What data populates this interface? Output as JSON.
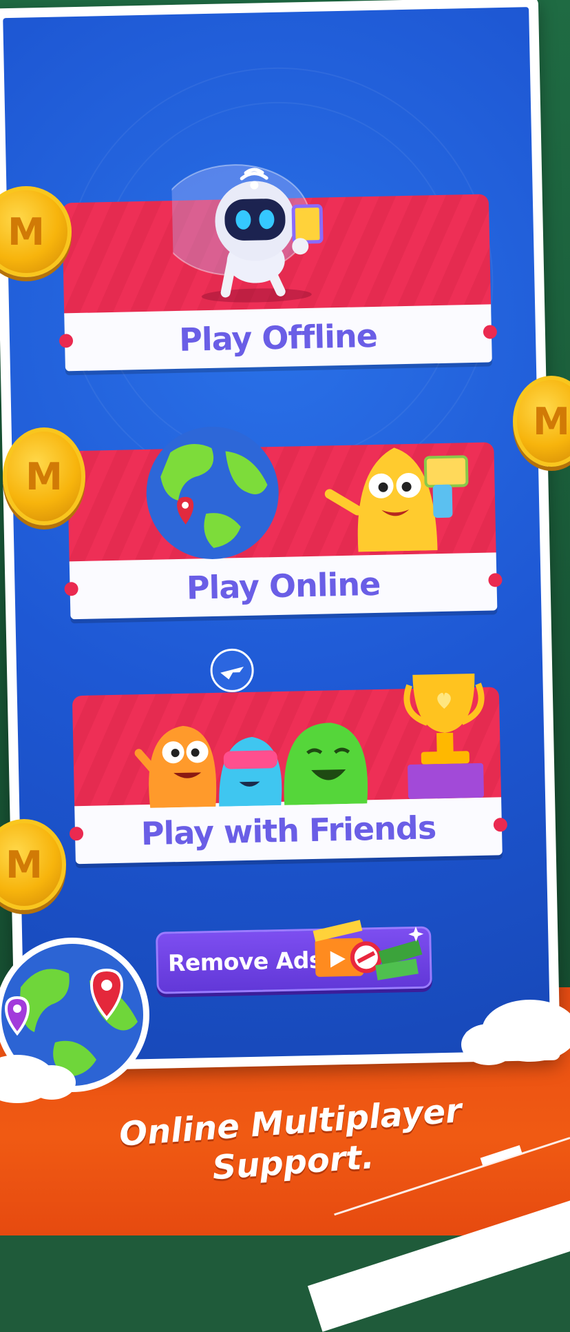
{
  "menu": {
    "play_offline": "Play Offline",
    "play_online": "Play Online",
    "play_with_friends": "Play with Friends",
    "remove_ads": "Remove Ads"
  },
  "coin_symbol": "M",
  "promo": {
    "line1": "Online Multiplayer",
    "line2": "Support."
  },
  "colors": {
    "screen_blue": "#1e58d4",
    "card_red": "#ee2f56",
    "label_purple": "#6a5ee6",
    "coin_gold": "#f7b40c",
    "banner_orange": "#f05a13",
    "frame_green": "#1f6b43"
  }
}
